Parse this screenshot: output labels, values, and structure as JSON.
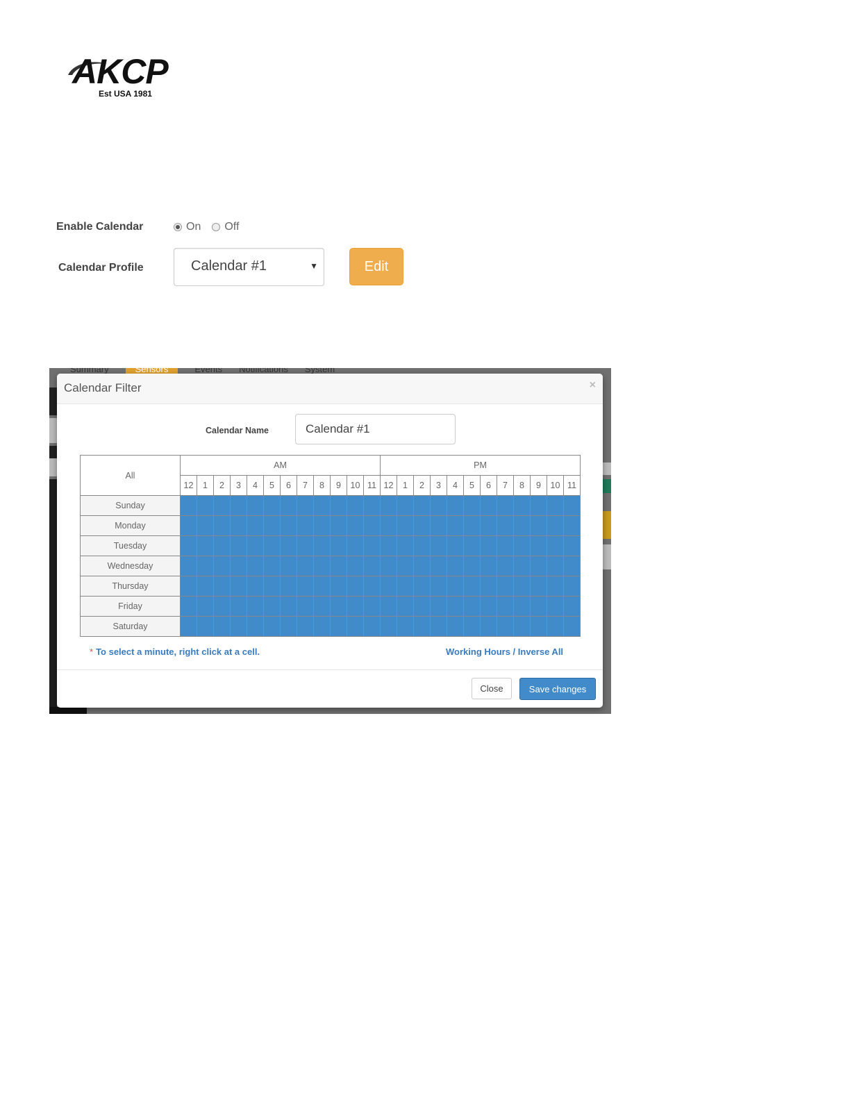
{
  "logo": {
    "brand": "AKCP",
    "tagline": "Est USA 1981"
  },
  "form": {
    "enable_label": "Enable Calendar",
    "radio_on": "On",
    "radio_off": "Off",
    "selected": "On",
    "profile_label": "Calendar Profile",
    "profile_value": "Calendar #1",
    "edit_label": "Edit"
  },
  "backdrop": {
    "tabs": [
      "Summary",
      "Sensors",
      "Events",
      "Notifications",
      "System"
    ]
  },
  "modal": {
    "title": "Calendar Filter",
    "close_glyph": "×",
    "name_label": "Calendar Name",
    "name_value": "Calendar #1",
    "grid": {
      "all_label": "All",
      "am_label": "AM",
      "pm_label": "PM",
      "hours": [
        "12",
        "1",
        "2",
        "3",
        "4",
        "5",
        "6",
        "7",
        "8",
        "9",
        "10",
        "11"
      ],
      "days": [
        "Sunday",
        "Monday",
        "Tuesday",
        "Wednesday",
        "Thursday",
        "Friday",
        "Saturday"
      ],
      "selected_color": "#428bca"
    },
    "note_star": "*",
    "note": "To select a minute, right click at a cell.",
    "inverse_link": "Working Hours / Inverse All",
    "close_button": "Close",
    "save_button": "Save changes"
  },
  "colors": {
    "edit": "#f0ad4e",
    "primary": "#428bca",
    "link": "#3a7bbf"
  }
}
